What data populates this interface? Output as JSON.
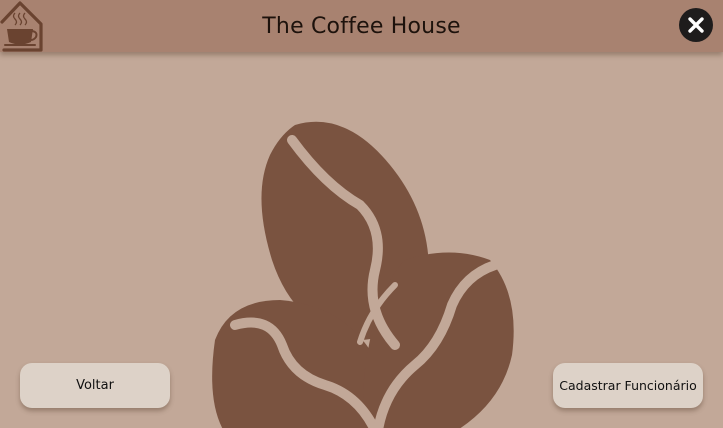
{
  "header": {
    "title": "The Coffee House",
    "home_icon": "house-coffee-cup-icon",
    "close_icon": "close-icon"
  },
  "illustration": {
    "icon": "coffee-beans-icon",
    "color": "#7a5340"
  },
  "actions": {
    "back_label": "Voltar",
    "register_label": "Cadastrar Funcionário"
  },
  "colors": {
    "background": "#c2a898",
    "header": "#a88270",
    "button": "#ddd2c8",
    "close_button": "#1e1c1c",
    "accent_brown": "#7a5340"
  }
}
